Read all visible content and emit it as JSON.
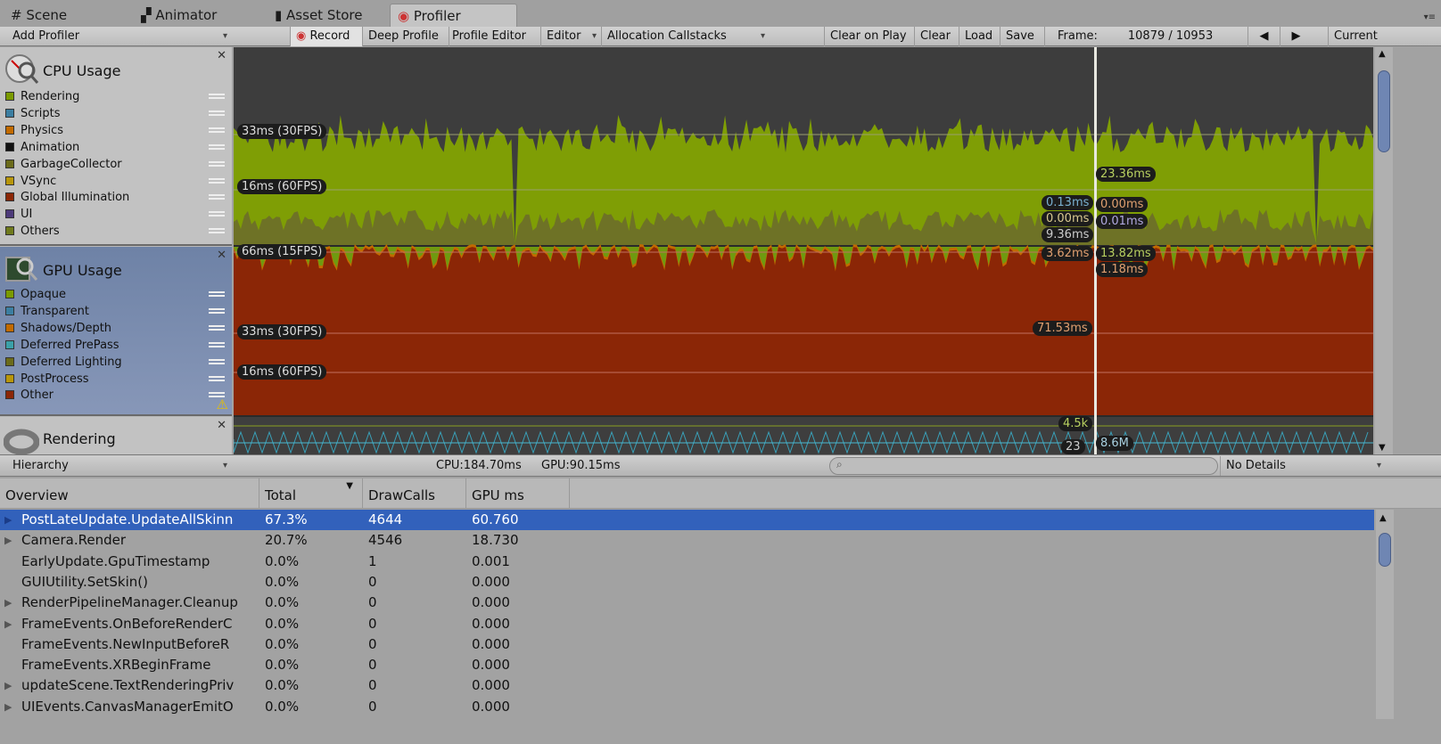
{
  "tabs": [
    {
      "label": "Scene",
      "icon": "grid-icon"
    },
    {
      "label": "Animator",
      "icon": "animator-icon"
    },
    {
      "label": "Asset Store",
      "icon": "bag-icon"
    },
    {
      "label": "Profiler",
      "icon": "profiler-icon",
      "active": true
    }
  ],
  "toolbar": {
    "add_profiler": "Add Profiler",
    "record": "Record",
    "deep_profile": "Deep Profile",
    "profile_editor": "Profile Editor",
    "target": "Editor",
    "allocation": "Allocation Callstacks",
    "clear_on_play": "Clear on Play",
    "clear": "Clear",
    "load": "Load",
    "save": "Save",
    "frame_label": "Frame:",
    "frame_value": "10879 / 10953",
    "current": "Current"
  },
  "cpu": {
    "title": "CPU Usage",
    "legend": [
      {
        "label": "Rendering",
        "color": "#7a9a00"
      },
      {
        "label": "Scripts",
        "color": "#3b7ea1"
      },
      {
        "label": "Physics",
        "color": "#c26a00"
      },
      {
        "label": "Animation",
        "color": "#111111"
      },
      {
        "label": "GarbageCollector",
        "color": "#6b6b1a"
      },
      {
        "label": "VSync",
        "color": "#b8960b"
      },
      {
        "label": "Global Illumination",
        "color": "#8b2606"
      },
      {
        "label": "UI",
        "color": "#4d3a7a"
      },
      {
        "label": "Others",
        "color": "#6f7a1c"
      }
    ],
    "grid": [
      "33ms (30FPS)",
      "16ms (60FPS)"
    ],
    "labels_left": [
      "0.13ms",
      "0.00ms",
      "9.36ms"
    ],
    "labels_right": [
      "23.36ms",
      "0.00ms",
      "0.01ms"
    ]
  },
  "gpu": {
    "title": "GPU Usage",
    "legend": [
      {
        "label": "Opaque",
        "color": "#7a9a00"
      },
      {
        "label": "Transparent",
        "color": "#3b7ea1"
      },
      {
        "label": "Shadows/Depth",
        "color": "#c26a00"
      },
      {
        "label": "Deferred PrePass",
        "color": "#3aa0a8"
      },
      {
        "label": "Deferred Lighting",
        "color": "#6b6b1a"
      },
      {
        "label": "PostProcess",
        "color": "#b8960b"
      },
      {
        "label": "Other",
        "color": "#8b2606"
      }
    ],
    "grid": [
      "66ms (15FPS)",
      "33ms (30FPS)",
      "16ms (60FPS)"
    ],
    "labels_left": [
      "3.62ms",
      "71.53ms"
    ],
    "labels_right": [
      "13.82ms",
      "1.18ms"
    ]
  },
  "rendering": {
    "title": "Rendering",
    "labels": [
      "4.5k",
      "8.6M",
      "23"
    ]
  },
  "hierarchy": {
    "view": "Hierarchy",
    "cpu": "CPU:184.70ms",
    "gpu": "GPU:90.15ms",
    "search_placeholder": "",
    "details": "No Details"
  },
  "table": {
    "columns": [
      "Overview",
      "Total",
      "DrawCalls",
      "GPU ms"
    ],
    "rows": [
      {
        "name": "PostLateUpdate.UpdateAllSkinn",
        "total": "67.3%",
        "draw": "4644",
        "gpu": "60.760",
        "expand": true,
        "selected": true
      },
      {
        "name": "Camera.Render",
        "total": "20.7%",
        "draw": "4546",
        "gpu": "18.730",
        "expand": true
      },
      {
        "name": "EarlyUpdate.GpuTimestamp",
        "total": "0.0%",
        "draw": "1",
        "gpu": "0.001"
      },
      {
        "name": "GUIUtility.SetSkin()",
        "total": "0.0%",
        "draw": "0",
        "gpu": "0.000"
      },
      {
        "name": "RenderPipelineManager.Cleanup",
        "total": "0.0%",
        "draw": "0",
        "gpu": "0.000",
        "expand": true
      },
      {
        "name": "FrameEvents.OnBeforeRenderC",
        "total": "0.0%",
        "draw": "0",
        "gpu": "0.000",
        "expand": true
      },
      {
        "name": "FrameEvents.NewInputBeforeR",
        "total": "0.0%",
        "draw": "0",
        "gpu": "0.000"
      },
      {
        "name": "FrameEvents.XRBeginFrame",
        "total": "0.0%",
        "draw": "0",
        "gpu": "0.000"
      },
      {
        "name": "updateScene.TextRenderingPriv",
        "total": "0.0%",
        "draw": "0",
        "gpu": "0.000",
        "expand": true
      },
      {
        "name": "UIEvents.CanvasManagerEmitO",
        "total": "0.0%",
        "draw": "0",
        "gpu": "0.000",
        "expand": true
      }
    ]
  }
}
